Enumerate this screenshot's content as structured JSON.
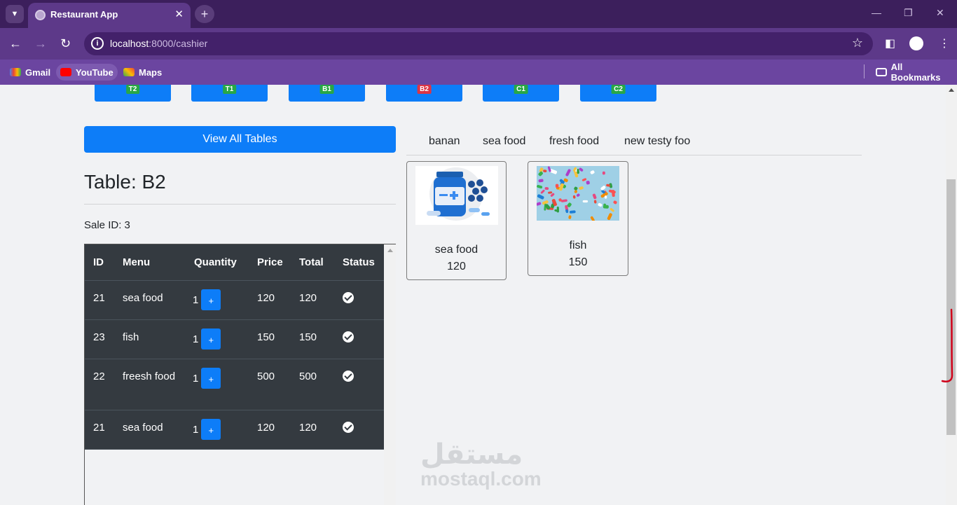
{
  "browser": {
    "tab_title": "Restaurant App",
    "url_host": "localhost",
    "url_path": ":8000/cashier",
    "bookmarks": [
      "Gmail",
      "YouTube",
      "Maps"
    ],
    "all_bookmarks": "All Bookmarks"
  },
  "tables": [
    {
      "label": "T2",
      "color": "#28a745"
    },
    {
      "label": "T1",
      "color": "#28a745"
    },
    {
      "label": "B1",
      "color": "#28a745"
    },
    {
      "label": "B2",
      "color": "#dc3545"
    },
    {
      "label": "C1",
      "color": "#28a745"
    },
    {
      "label": "C2",
      "color": "#28a745"
    }
  ],
  "view_all_label": "View All Tables",
  "table_title": "Table: B2",
  "sale_id": "Sale ID: 3",
  "orders": {
    "headers": [
      "ID",
      "Menu",
      "Quantity",
      "Price",
      "Total",
      "Status"
    ],
    "rows": [
      {
        "id": "21",
        "menu": "sea food",
        "qty": "1",
        "price": "120",
        "total": "120"
      },
      {
        "id": "23",
        "menu": "fish",
        "qty": "1",
        "price": "150",
        "total": "150"
      },
      {
        "id": "22",
        "menu": "freesh food",
        "qty": "1",
        "price": "500",
        "total": "500"
      },
      {
        "id": "21",
        "menu": "sea food",
        "qty": "1",
        "price": "120",
        "total": "120"
      }
    ],
    "plus_label": "+"
  },
  "categories": [
    "banan",
    "sea food",
    "fresh food",
    "new testy foo"
  ],
  "menu_items": [
    {
      "name": "sea food",
      "price": "120",
      "image": "medicine-bottle-illustration"
    },
    {
      "name": "fish",
      "price": "150",
      "image": "colorful-pills-photo"
    }
  ],
  "watermark": {
    "arabic": "مستقل",
    "latin": "mostaql.com"
  }
}
